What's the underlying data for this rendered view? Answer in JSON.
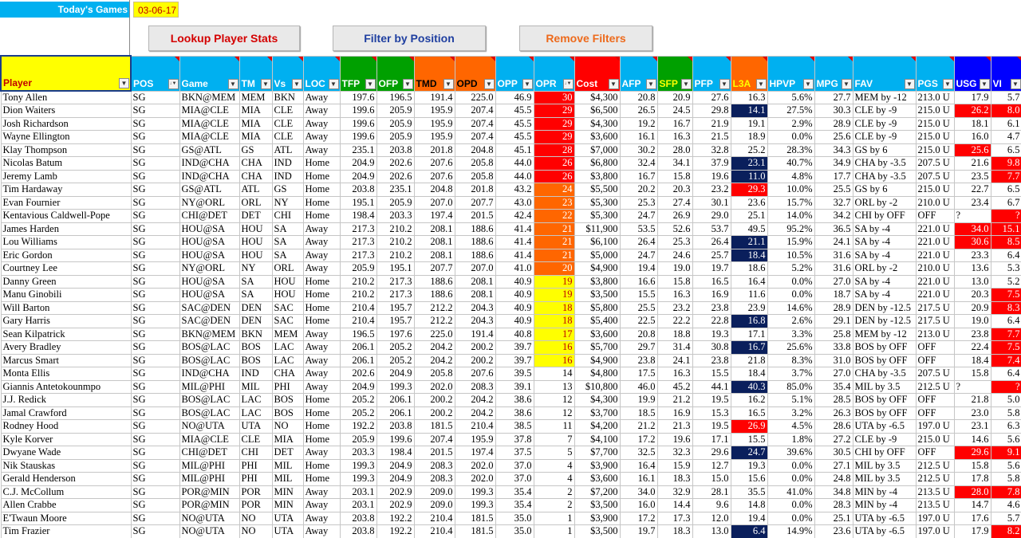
{
  "todays_games_label": "Today's Games",
  "date": "03-06-17",
  "buttons": {
    "lookup": "Lookup Player Stats",
    "filter": "Filter by Position",
    "remove": "Remove Filters"
  },
  "columns": [
    "Player",
    "POS",
    "Game",
    "TM",
    "Vs",
    "LOC",
    "TFP",
    "OFP",
    "TMD",
    "OPD",
    "OPP",
    "OPR",
    "Cost",
    "AFP",
    "SFP",
    "PFP",
    "L3A",
    "HPVP",
    "MPG",
    "FAV",
    "PGS",
    "USG",
    "VI"
  ],
  "header_colors": [
    "player",
    "blue",
    "blue",
    "blue",
    "blue",
    "blue",
    "green",
    "green",
    "orange",
    "orange",
    "blue",
    "blue",
    "red",
    "blue",
    "sfp",
    "blue",
    "l3a",
    "blue",
    "blue",
    "blue",
    "blue",
    "usg",
    "usg"
  ],
  "sort_filter_columns": [
    "POS",
    "OPR"
  ],
  "highlight_colors": {
    "red": "#FF0000",
    "orange": "#FF6600",
    "yellow": "#FFFF00",
    "navy": "#0A1F5C"
  },
  "rows": [
    {
      "c": [
        "Tony Allen",
        "SG",
        "BKN@MEM",
        "MEM",
        "BKN",
        "Away",
        "197.6",
        "196.5",
        "191.4",
        "225.0",
        "46.9",
        "30",
        "$4,300",
        "20.8",
        "20.9",
        "27.6",
        "16.3",
        "5.6%",
        "27.7",
        "MEM by -12",
        "213.0 U",
        "17.9",
        "5.7"
      ],
      "h": {
        "11": "red"
      }
    },
    {
      "c": [
        "Dion Waiters",
        "SG",
        "MIA@CLE",
        "MIA",
        "CLE",
        "Away",
        "199.6",
        "205.9",
        "195.9",
        "207.4",
        "45.5",
        "29",
        "$6,500",
        "26.5",
        "24.5",
        "29.8",
        "14.1",
        "27.5%",
        "30.3",
        "CLE by -9",
        "215.0 U",
        "26.2",
        "8.0"
      ],
      "h": {
        "11": "red",
        "16": "navy",
        "21": "red",
        "22": "red"
      }
    },
    {
      "c": [
        "Josh Richardson",
        "SG",
        "MIA@CLE",
        "MIA",
        "CLE",
        "Away",
        "199.6",
        "205.9",
        "195.9",
        "207.4",
        "45.5",
        "29",
        "$4,300",
        "19.2",
        "16.7",
        "21.9",
        "19.1",
        "2.9%",
        "28.9",
        "CLE by -9",
        "215.0 U",
        "18.1",
        "6.1"
      ],
      "h": {
        "11": "red"
      }
    },
    {
      "c": [
        "Wayne Ellington",
        "SG",
        "MIA@CLE",
        "MIA",
        "CLE",
        "Away",
        "199.6",
        "205.9",
        "195.9",
        "207.4",
        "45.5",
        "29",
        "$3,600",
        "16.1",
        "16.3",
        "21.5",
        "18.9",
        "0.0%",
        "25.6",
        "CLE by -9",
        "215.0 U",
        "16.0",
        "4.7"
      ],
      "h": {
        "11": "red"
      }
    },
    {
      "c": [
        "Klay Thompson",
        "SG",
        "GS@ATL",
        "GS",
        "ATL",
        "Away",
        "235.1",
        "203.8",
        "201.8",
        "204.8",
        "45.1",
        "28",
        "$7,000",
        "30.2",
        "28.0",
        "32.8",
        "25.2",
        "28.3%",
        "34.3",
        "GS by 6",
        "215.0 U",
        "25.6",
        "6.5"
      ],
      "h": {
        "11": "red",
        "21": "red"
      }
    },
    {
      "c": [
        "Nicolas Batum",
        "SG",
        "IND@CHA",
        "CHA",
        "IND",
        "Home",
        "204.9",
        "202.6",
        "207.6",
        "205.8",
        "44.0",
        "26",
        "$6,800",
        "32.4",
        "34.1",
        "37.9",
        "23.1",
        "40.7%",
        "34.9",
        "CHA by -3.5",
        "207.5 U",
        "21.6",
        "9.8"
      ],
      "h": {
        "11": "red",
        "16": "navy",
        "22": "red"
      }
    },
    {
      "c": [
        "Jeremy Lamb",
        "SG",
        "IND@CHA",
        "CHA",
        "IND",
        "Home",
        "204.9",
        "202.6",
        "207.6",
        "205.8",
        "44.0",
        "26",
        "$3,800",
        "16.7",
        "15.8",
        "19.6",
        "11.0",
        "4.8%",
        "17.7",
        "CHA by -3.5",
        "207.5 U",
        "23.5",
        "7.7"
      ],
      "h": {
        "11": "red",
        "16": "navy",
        "22": "red"
      }
    },
    {
      "c": [
        "Tim Hardaway",
        "SG",
        "GS@ATL",
        "ATL",
        "GS",
        "Home",
        "203.8",
        "235.1",
        "204.8",
        "201.8",
        "43.2",
        "24",
        "$5,500",
        "20.2",
        "20.3",
        "23.2",
        "29.3",
        "10.0%",
        "25.5",
        "GS by 6",
        "215.0 U",
        "22.7",
        "6.5"
      ],
      "h": {
        "11": "orange",
        "16": "red"
      }
    },
    {
      "c": [
        "Evan Fournier",
        "SG",
        "NY@ORL",
        "ORL",
        "NY",
        "Home",
        "195.1",
        "205.9",
        "207.0",
        "207.7",
        "43.0",
        "23",
        "$5,300",
        "25.3",
        "27.4",
        "30.1",
        "23.6",
        "15.7%",
        "32.7",
        "ORL by -2",
        "210.0 U",
        "23.4",
        "6.7"
      ],
      "h": {
        "11": "orange"
      }
    },
    {
      "c": [
        "Kentavious Caldwell-Pope",
        "SG",
        "CHI@DET",
        "DET",
        "CHI",
        "Home",
        "198.4",
        "203.3",
        "197.4",
        "201.5",
        "42.4",
        "22",
        "$5,300",
        "24.7",
        "26.9",
        "29.0",
        "25.1",
        "14.0%",
        "34.2",
        "CHI by OFF",
        "OFF",
        "?",
        "?"
      ],
      "h": {
        "11": "orange",
        "22": "red"
      }
    },
    {
      "c": [
        "James Harden",
        "SG",
        "HOU@SA",
        "HOU",
        "SA",
        "Away",
        "217.3",
        "210.2",
        "208.1",
        "188.6",
        "41.4",
        "21",
        "$11,900",
        "53.5",
        "52.6",
        "53.7",
        "49.5",
        "95.2%",
        "36.5",
        "SA by -4",
        "221.0 U",
        "34.0",
        "15.1"
      ],
      "h": {
        "11": "orange",
        "21": "red",
        "22": "red"
      }
    },
    {
      "c": [
        "Lou Williams",
        "SG",
        "HOU@SA",
        "HOU",
        "SA",
        "Away",
        "217.3",
        "210.2",
        "208.1",
        "188.6",
        "41.4",
        "21",
        "$6,100",
        "26.4",
        "25.3",
        "26.4",
        "21.1",
        "15.9%",
        "24.1",
        "SA by -4",
        "221.0 U",
        "30.6",
        "8.5"
      ],
      "h": {
        "11": "orange",
        "16": "navy",
        "21": "red",
        "22": "red"
      }
    },
    {
      "c": [
        "Eric Gordon",
        "SG",
        "HOU@SA",
        "HOU",
        "SA",
        "Away",
        "217.3",
        "210.2",
        "208.1",
        "188.6",
        "41.4",
        "21",
        "$5,000",
        "24.7",
        "24.6",
        "25.7",
        "18.4",
        "10.5%",
        "31.6",
        "SA by -4",
        "221.0 U",
        "23.3",
        "6.4"
      ],
      "h": {
        "11": "orange",
        "16": "navy"
      }
    },
    {
      "c": [
        "Courtney Lee",
        "SG",
        "NY@ORL",
        "NY",
        "ORL",
        "Away",
        "205.9",
        "195.1",
        "207.7",
        "207.0",
        "41.0",
        "20",
        "$4,900",
        "19.4",
        "19.0",
        "19.7",
        "18.6",
        "5.2%",
        "31.6",
        "ORL by -2",
        "210.0 U",
        "13.6",
        "5.3"
      ],
      "h": {
        "11": "orange"
      }
    },
    {
      "c": [
        "Danny Green",
        "SG",
        "HOU@SA",
        "SA",
        "HOU",
        "Home",
        "210.2",
        "217.3",
        "188.6",
        "208.1",
        "40.9",
        "19",
        "$3,800",
        "16.6",
        "15.8",
        "16.5",
        "16.4",
        "0.0%",
        "27.0",
        "SA by -4",
        "221.0 U",
        "13.0",
        "5.2"
      ],
      "h": {
        "11": "yellow"
      }
    },
    {
      "c": [
        "Manu Ginobili",
        "SG",
        "HOU@SA",
        "SA",
        "HOU",
        "Home",
        "210.2",
        "217.3",
        "188.6",
        "208.1",
        "40.9",
        "19",
        "$3,500",
        "15.5",
        "16.3",
        "16.9",
        "11.6",
        "0.0%",
        "18.7",
        "SA by -4",
        "221.0 U",
        "20.3",
        "7.5"
      ],
      "h": {
        "11": "yellow",
        "22": "red"
      }
    },
    {
      "c": [
        "Will Barton",
        "SG",
        "SAC@DEN",
        "DEN",
        "SAC",
        "Home",
        "210.4",
        "195.7",
        "212.2",
        "204.3",
        "40.9",
        "18",
        "$5,800",
        "25.5",
        "23.2",
        "23.8",
        "23.9",
        "14.6%",
        "28.9",
        "DEN by -12.5",
        "217.5 U",
        "20.9",
        "8.3"
      ],
      "h": {
        "11": "yellow",
        "22": "red"
      }
    },
    {
      "c": [
        "Gary Harris",
        "SG",
        "SAC@DEN",
        "DEN",
        "SAC",
        "Home",
        "210.4",
        "195.7",
        "212.2",
        "204.3",
        "40.9",
        "18",
        "$5,400",
        "22.5",
        "22.2",
        "22.8",
        "16.8",
        "2.6%",
        "29.1",
        "DEN by -12.5",
        "217.5 U",
        "19.0",
        "6.4"
      ],
      "h": {
        "11": "yellow",
        "16": "navy"
      }
    },
    {
      "c": [
        "Sean Kilpatrick",
        "SG",
        "BKN@MEM",
        "BKN",
        "MEM",
        "Away",
        "196.5",
        "197.6",
        "225.0",
        "191.4",
        "40.8",
        "17",
        "$3,600",
        "20.8",
        "18.8",
        "19.3",
        "17.1",
        "3.3%",
        "25.8",
        "MEM by -12",
        "213.0 U",
        "23.8",
        "7.7"
      ],
      "h": {
        "11": "yellow",
        "22": "red"
      }
    },
    {
      "c": [
        "Avery Bradley",
        "SG",
        "BOS@LAC",
        "BOS",
        "LAC",
        "Away",
        "206.1",
        "205.2",
        "204.2",
        "200.2",
        "39.7",
        "16",
        "$5,700",
        "29.7",
        "31.4",
        "30.8",
        "16.7",
        "25.6%",
        "33.8",
        "BOS by OFF",
        "OFF",
        "22.4",
        "7.5"
      ],
      "h": {
        "11": "yellow",
        "16": "navy",
        "22": "red"
      }
    },
    {
      "c": [
        "Marcus Smart",
        "SG",
        "BOS@LAC",
        "BOS",
        "LAC",
        "Away",
        "206.1",
        "205.2",
        "204.2",
        "200.2",
        "39.7",
        "16",
        "$4,900",
        "23.8",
        "24.1",
        "23.8",
        "21.8",
        "8.3%",
        "31.0",
        "BOS by OFF",
        "OFF",
        "18.4",
        "7.4"
      ],
      "h": {
        "11": "yellow",
        "22": "red"
      }
    },
    {
      "c": [
        "Monta Ellis",
        "SG",
        "IND@CHA",
        "IND",
        "CHA",
        "Away",
        "202.6",
        "204.9",
        "205.8",
        "207.6",
        "39.5",
        "14",
        "$4,800",
        "17.5",
        "16.3",
        "15.5",
        "18.4",
        "3.7%",
        "27.0",
        "CHA by -3.5",
        "207.5 U",
        "15.8",
        "6.4"
      ],
      "h": {}
    },
    {
      "c": [
        "Giannis Antetokounmpo",
        "SG",
        "MIL@PHI",
        "MIL",
        "PHI",
        "Away",
        "204.9",
        "199.3",
        "202.0",
        "208.3",
        "39.1",
        "13",
        "$10,800",
        "46.0",
        "45.2",
        "44.1",
        "40.3",
        "85.0%",
        "35.4",
        "MIL by 3.5",
        "212.5 U",
        "?",
        "?"
      ],
      "h": {
        "16": "navy",
        "22": "red"
      }
    },
    {
      "c": [
        "J.J. Redick",
        "SG",
        "BOS@LAC",
        "LAC",
        "BOS",
        "Home",
        "205.2",
        "206.1",
        "200.2",
        "204.2",
        "38.6",
        "12",
        "$4,300",
        "19.9",
        "21.2",
        "19.5",
        "16.2",
        "5.1%",
        "28.5",
        "BOS by OFF",
        "OFF",
        "21.8",
        "5.0"
      ],
      "h": {}
    },
    {
      "c": [
        "Jamal Crawford",
        "SG",
        "BOS@LAC",
        "LAC",
        "BOS",
        "Home",
        "205.2",
        "206.1",
        "200.2",
        "204.2",
        "38.6",
        "12",
        "$3,700",
        "18.5",
        "16.9",
        "15.3",
        "16.5",
        "3.2%",
        "26.3",
        "BOS by OFF",
        "OFF",
        "23.0",
        "5.8"
      ],
      "h": {}
    },
    {
      "c": [
        "Rodney Hood",
        "SG",
        "NO@UTA",
        "UTA",
        "NO",
        "Home",
        "192.2",
        "203.8",
        "181.5",
        "210.4",
        "38.5",
        "11",
        "$4,200",
        "21.2",
        "21.3",
        "19.5",
        "26.9",
        "4.5%",
        "28.6",
        "UTA by -6.5",
        "197.0 U",
        "23.1",
        "6.3"
      ],
      "h": {
        "16": "red"
      }
    },
    {
      "c": [
        "Kyle Korver",
        "SG",
        "MIA@CLE",
        "CLE",
        "MIA",
        "Home",
        "205.9",
        "199.6",
        "207.4",
        "195.9",
        "37.8",
        "7",
        "$4,100",
        "17.2",
        "19.6",
        "17.1",
        "15.5",
        "1.8%",
        "27.2",
        "CLE by -9",
        "215.0 U",
        "14.6",
        "5.6"
      ],
      "h": {}
    },
    {
      "c": [
        "Dwyane Wade",
        "SG",
        "CHI@DET",
        "CHI",
        "DET",
        "Away",
        "203.3",
        "198.4",
        "201.5",
        "197.4",
        "37.5",
        "5",
        "$7,700",
        "32.5",
        "32.3",
        "29.6",
        "24.7",
        "39.6%",
        "30.5",
        "CHI by OFF",
        "OFF",
        "29.6",
        "9.1"
      ],
      "h": {
        "16": "navy",
        "21": "red",
        "22": "red"
      }
    },
    {
      "c": [
        "Nik Stauskas",
        "SG",
        "MIL@PHI",
        "PHI",
        "MIL",
        "Home",
        "199.3",
        "204.9",
        "208.3",
        "202.0",
        "37.0",
        "4",
        "$3,900",
        "16.4",
        "15.9",
        "12.7",
        "19.3",
        "0.0%",
        "27.1",
        "MIL by 3.5",
        "212.5 U",
        "15.8",
        "5.6"
      ],
      "h": {}
    },
    {
      "c": [
        "Gerald Henderson",
        "SG",
        "MIL@PHI",
        "PHI",
        "MIL",
        "Home",
        "199.3",
        "204.9",
        "208.3",
        "202.0",
        "37.0",
        "4",
        "$3,600",
        "16.1",
        "18.3",
        "15.0",
        "15.6",
        "0.0%",
        "24.8",
        "MIL by 3.5",
        "212.5 U",
        "17.8",
        "5.8"
      ],
      "h": {}
    },
    {
      "c": [
        "C.J. McCollum",
        "SG",
        "POR@MIN",
        "POR",
        "MIN",
        "Away",
        "203.1",
        "202.9",
        "209.0",
        "199.3",
        "35.4",
        "2",
        "$7,200",
        "34.0",
        "32.9",
        "28.1",
        "35.5",
        "41.0%",
        "34.8",
        "MIN by -4",
        "213.5 U",
        "28.0",
        "7.8"
      ],
      "h": {
        "21": "red",
        "22": "red"
      }
    },
    {
      "c": [
        "Allen Crabbe",
        "SG",
        "POR@MIN",
        "POR",
        "MIN",
        "Away",
        "203.1",
        "202.9",
        "209.0",
        "199.3",
        "35.4",
        "2",
        "$3,500",
        "16.0",
        "14.4",
        "9.6",
        "14.8",
        "0.0%",
        "28.3",
        "MIN by -4",
        "213.5 U",
        "14.7",
        "4.6"
      ],
      "h": {}
    },
    {
      "c": [
        "E'Twaun Moore",
        "SG",
        "NO@UTA",
        "NO",
        "UTA",
        "Away",
        "203.8",
        "192.2",
        "210.4",
        "181.5",
        "35.0",
        "1",
        "$3,900",
        "17.2",
        "17.3",
        "12.0",
        "19.4",
        "0.0%",
        "25.1",
        "UTA by -6.5",
        "197.0 U",
        "17.6",
        "5.7"
      ],
      "h": {}
    },
    {
      "c": [
        "Tim Frazier",
        "SG",
        "NO@UTA",
        "NO",
        "UTA",
        "Away",
        "203.8",
        "192.2",
        "210.4",
        "181.5",
        "35.0",
        "1",
        "$3,500",
        "19.7",
        "18.3",
        "13.0",
        "6.4",
        "14.9%",
        "23.6",
        "UTA by -6.5",
        "197.0 U",
        "17.9",
        "8.2"
      ],
      "h": {
        "16": "navy",
        "22": "red"
      }
    }
  ]
}
